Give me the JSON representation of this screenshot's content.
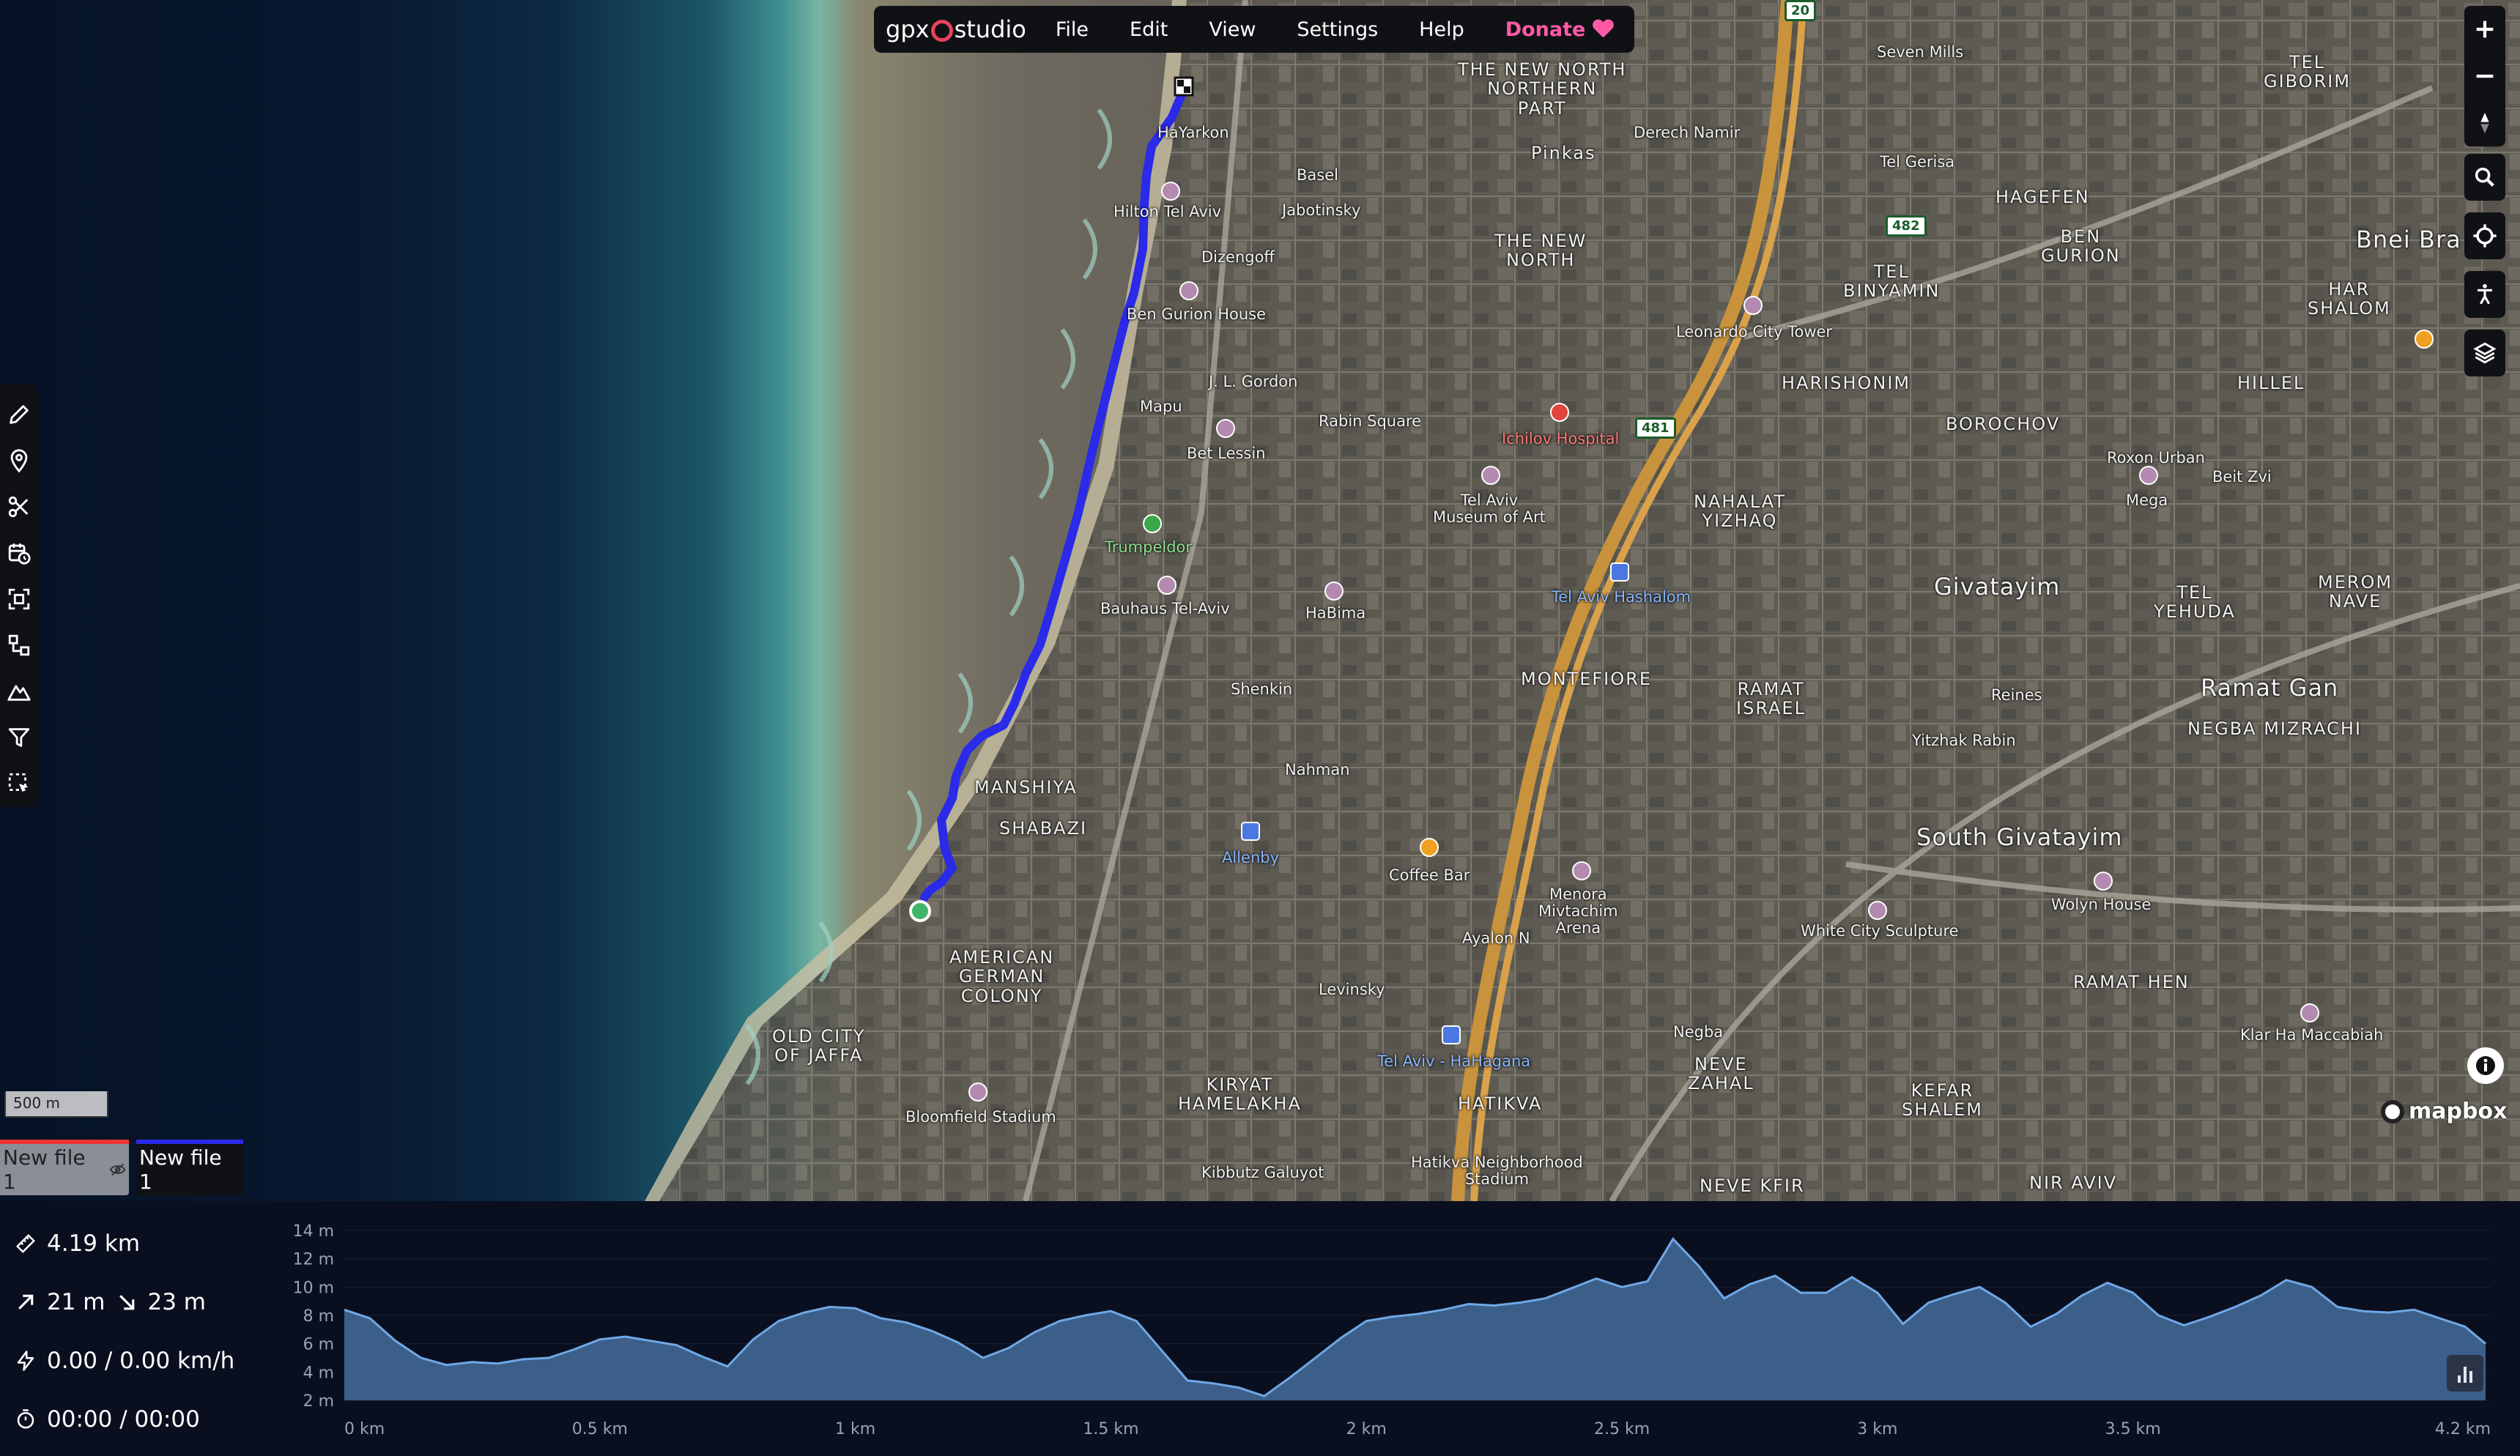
{
  "app": {
    "logo_left": "gpx",
    "logo_right": "studio"
  },
  "menu": {
    "items": [
      "File",
      "Edit",
      "View",
      "Settings",
      "Help"
    ],
    "donate": "Donate"
  },
  "toolbar": {
    "tools": [
      "pencil-icon",
      "map-pin-icon",
      "scissors-icon",
      "calendar-time-icon",
      "focus-scan-icon",
      "merge-icon",
      "elevation-icon",
      "filter-icon",
      "select-icon"
    ]
  },
  "right_controls": {
    "zoom": [
      "zoom-in-icon",
      "zoom-out-icon",
      "compass-icon"
    ],
    "buttons": [
      "search-icon",
      "locate-icon",
      "street-view-icon",
      "layers-icon"
    ]
  },
  "map": {
    "scale": "500 m",
    "attribution": "mapbox",
    "labels": [
      {
        "t": "THE NEW NORTH\nNORTHERN\nPART",
        "c": ""
      },
      {
        "t": "Pinkas",
        "c": ""
      },
      {
        "t": "Hilton Tel Aviv",
        "c": ""
      },
      {
        "t": "Basel",
        "c": ""
      },
      {
        "t": "Jabotinsky",
        "c": ""
      },
      {
        "t": "THE NEW\nNORTH",
        "c": ""
      },
      {
        "t": "Ben Gurion House",
        "c": ""
      },
      {
        "t": "Dizengoff",
        "c": ""
      },
      {
        "t": "J. L. Gordon",
        "c": ""
      },
      {
        "t": "Rabin Square",
        "c": ""
      },
      {
        "t": "Ichilov Hospital",
        "c": "red"
      },
      {
        "t": "Bet Lessin",
        "c": ""
      },
      {
        "t": "Mapu",
        "c": ""
      },
      {
        "t": "Tel Aviv\nMuseum of Art",
        "c": ""
      },
      {
        "t": "Trumpeldor",
        "c": "green"
      },
      {
        "t": "Bauhaus Tel-Aviv",
        "c": ""
      },
      {
        "t": "HaBima",
        "c": ""
      },
      {
        "t": "Tel Aviv Hashalom",
        "c": "blue"
      },
      {
        "t": "MONTEFIORE",
        "c": ""
      },
      {
        "t": "NAHALAT\nYIZHAQ",
        "c": ""
      },
      {
        "t": "Givatayim",
        "c": "big"
      },
      {
        "t": "Ramat Gan",
        "c": "big"
      },
      {
        "t": "MANSHIYA",
        "c": ""
      },
      {
        "t": "SHABAZI",
        "c": ""
      },
      {
        "t": "Allenby",
        "c": "blue"
      },
      {
        "t": "Coffee Bar",
        "c": ""
      },
      {
        "t": "Menora\nMivtachim\nArena",
        "c": ""
      },
      {
        "t": "AMERICAN\nGERMAN\nCOLONY",
        "c": ""
      },
      {
        "t": "OLD CITY\nOF JAFFA",
        "c": ""
      },
      {
        "t": "Bloomfield Stadium",
        "c": ""
      },
      {
        "t": "KIRYAT\nHAMELAKHA",
        "c": ""
      },
      {
        "t": "Tel Aviv - HaHagana",
        "c": "blue"
      },
      {
        "t": "HATIKVA",
        "c": ""
      },
      {
        "t": "Hatikva Neighborhood\nStadium",
        "c": ""
      },
      {
        "t": "NEVE\nZAHAL",
        "c": ""
      },
      {
        "t": "NEVE KFIR",
        "c": ""
      },
      {
        "t": "KEFAR\nSHALEM",
        "c": ""
      },
      {
        "t": "NIR AVIV",
        "c": ""
      },
      {
        "t": "South Givatayim",
        "c": "big"
      },
      {
        "t": "White City Sculpture",
        "c": ""
      },
      {
        "t": "Wolyn House",
        "c": ""
      },
      {
        "t": "RAMAT HEN",
        "c": ""
      },
      {
        "t": "Klar Ha Maccabiah",
        "c": ""
      },
      {
        "t": "Seven Mills",
        "c": ""
      },
      {
        "t": "Tel Gerisa",
        "c": ""
      },
      {
        "t": "HAGEFEN",
        "c": ""
      },
      {
        "t": "BEN\nGURION",
        "c": ""
      },
      {
        "t": "TEL\nBINYAMIN",
        "c": ""
      },
      {
        "t": "Leonardo City Tower",
        "c": ""
      },
      {
        "t": "HARISHONIM",
        "c": ""
      },
      {
        "t": "BOROCHOV",
        "c": ""
      },
      {
        "t": "Roxon Urban",
        "c": ""
      },
      {
        "t": "Mega",
        "c": ""
      },
      {
        "t": "Beit Zvi",
        "c": ""
      },
      {
        "t": "HILLEL",
        "c": ""
      },
      {
        "t": "HAR\nSHALOM",
        "c": ""
      },
      {
        "t": "TEL\nGIBORIM",
        "c": ""
      },
      {
        "t": "Bnei Bra",
        "c": "big"
      },
      {
        "t": "TEL\nYEHUDA",
        "c": ""
      },
      {
        "t": "MEROM\nNAVE",
        "c": ""
      },
      {
        "t": "NEGBA MIZRACHI",
        "c": ""
      },
      {
        "t": "RAMAT\nISRAEL",
        "c": ""
      },
      {
        "t": "Reines",
        "c": ""
      },
      {
        "t": "Yitzhak Rabin",
        "c": ""
      },
      {
        "t": "Levinsky",
        "c": ""
      },
      {
        "t": "Nahman",
        "c": ""
      },
      {
        "t": "Shenkin",
        "c": ""
      },
      {
        "t": "HaYarkon",
        "c": ""
      },
      {
        "t": "Derech Namir",
        "c": ""
      },
      {
        "t": "Ayalon N",
        "c": ""
      },
      {
        "t": "Negba",
        "c": ""
      },
      {
        "t": "Kibbutz Galuyot",
        "c": ""
      }
    ],
    "shields": [
      "20",
      "482",
      "481"
    ]
  },
  "files": {
    "tabs": [
      {
        "label": "New file 1",
        "hidden": true
      },
      {
        "label": "New file 1",
        "hidden": false
      }
    ]
  },
  "stats": {
    "distance": "4.19 km",
    "elevation_up": "21 m",
    "elevation_down": "23 m",
    "speed": "0.00 / 0.00 km/h",
    "time": "00:00 / 00:00"
  },
  "chart_data": {
    "type": "area",
    "title": "",
    "xlabel": "",
    "ylabel": "",
    "x_ticks": [
      "0 km",
      "0.5 km",
      "1 km",
      "1.5 km",
      "2 km",
      "2.5 km",
      "3 km",
      "3.5 km",
      "4.2 km"
    ],
    "y_ticks": [
      "14 m",
      "12 m",
      "10 m",
      "8 m",
      "6 m",
      "4 m",
      "2 m"
    ],
    "ylim": [
      2,
      14
    ],
    "xlim": [
      0,
      4.2
    ],
    "x": [
      0,
      0.05,
      0.1,
      0.15,
      0.2,
      0.25,
      0.3,
      0.35,
      0.4,
      0.45,
      0.5,
      0.55,
      0.6,
      0.65,
      0.7,
      0.75,
      0.8,
      0.85,
      0.9,
      0.95,
      1.0,
      1.05,
      1.1,
      1.15,
      1.2,
      1.25,
      1.3,
      1.35,
      1.4,
      1.45,
      1.5,
      1.55,
      1.6,
      1.65,
      1.7,
      1.75,
      1.8,
      1.85,
      1.9,
      1.95,
      2.0,
      2.05,
      2.1,
      2.15,
      2.2,
      2.25,
      2.3,
      2.35,
      2.4,
      2.45,
      2.5,
      2.55,
      2.6,
      2.65,
      2.7,
      2.75,
      2.8,
      2.85,
      2.9,
      2.95,
      3.0,
      3.05,
      3.1,
      3.15,
      3.2,
      3.25,
      3.3,
      3.35,
      3.4,
      3.45,
      3.5,
      3.55,
      3.6,
      3.65,
      3.7,
      3.75,
      3.8,
      3.85,
      3.9,
      3.95,
      4.0,
      4.05,
      4.1,
      4.15,
      4.19
    ],
    "values": [
      8.4,
      7.8,
      6.2,
      5.0,
      4.5,
      4.7,
      4.6,
      4.9,
      5.0,
      5.6,
      6.3,
      6.5,
      6.2,
      5.9,
      5.1,
      4.4,
      6.3,
      7.6,
      8.2,
      8.6,
      8.5,
      7.8,
      7.5,
      6.9,
      6.1,
      5.0,
      5.7,
      6.8,
      7.6,
      8.0,
      8.3,
      7.6,
      5.5,
      3.4,
      3.2,
      2.9,
      2.3,
      3.6,
      5.0,
      6.4,
      7.6,
      7.9,
      8.1,
      8.4,
      8.8,
      8.7,
      8.9,
      9.2,
      9.9,
      10.6,
      10.0,
      10.4,
      13.4,
      11.5,
      9.2,
      10.2,
      10.8,
      9.6,
      9.6,
      10.7,
      9.6,
      7.4,
      8.9,
      9.5,
      10.0,
      8.9,
      7.2,
      8.1,
      9.4,
      10.3,
      9.6,
      8.0,
      7.3,
      7.9,
      8.6,
      9.4,
      10.5,
      10.0,
      8.6,
      8.3,
      8.2,
      8.4,
      7.8,
      7.2,
      6.0
    ]
  },
  "colors": {
    "accent_route": "#2a2ae8",
    "donate": "#ff5aa6",
    "chart_fill": "#3c5f8a",
    "chart_line": "#6fa8e6"
  }
}
